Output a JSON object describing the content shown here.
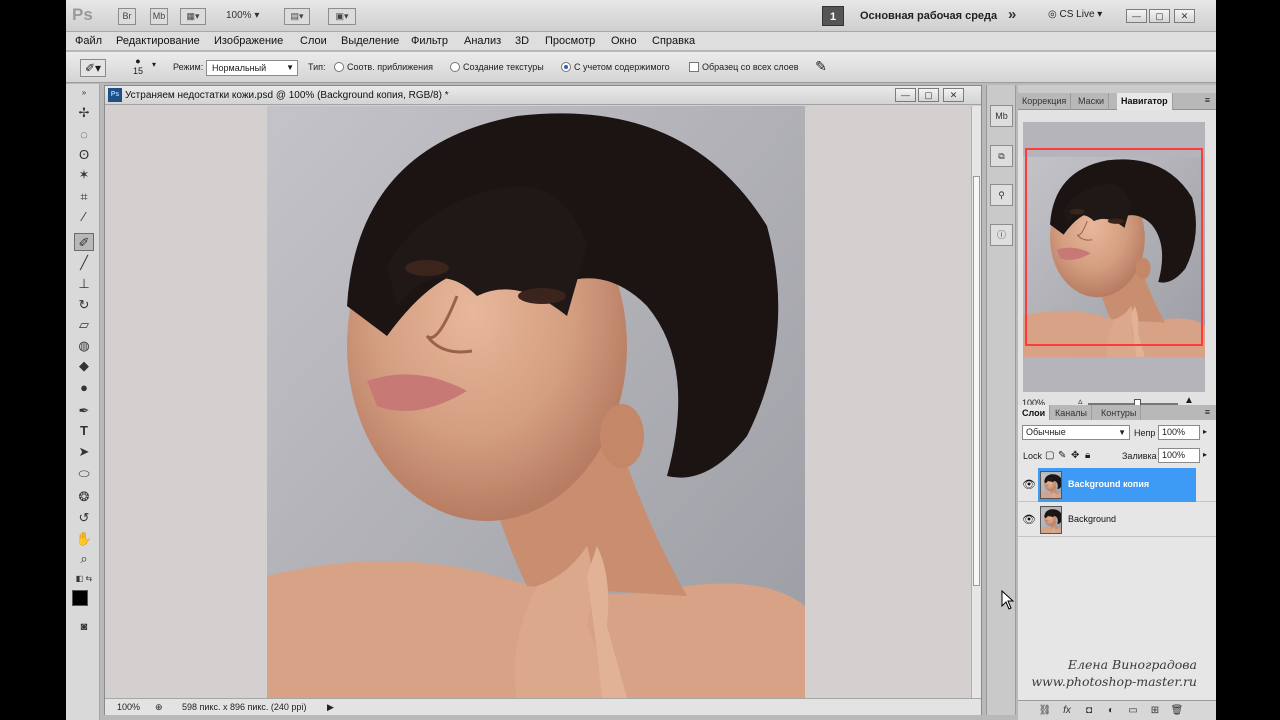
{
  "titlebar": {
    "logo": "Ps",
    "bridge": "Br",
    "minibridge": "Mb",
    "zoom": "100%",
    "workspace_number": "1",
    "workspace_name": "Основная рабочая среда",
    "cs_live": "CS Live"
  },
  "menu": [
    "Файл",
    "Редактирование",
    "Изображение",
    "Слои",
    "Выделение",
    "Фильтр",
    "Анализ",
    "3D",
    "Просмотр",
    "Окно",
    "Справка"
  ],
  "options": {
    "brush_size": "15",
    "mode_label": "Режим:",
    "mode_value": "Нормальный",
    "type_label": "Тип:",
    "type_options": [
      "Соотв. приближения",
      "Создание текстуры",
      "С учетом содержимого"
    ],
    "type_selected": "С учетом содержимого",
    "sample_all_label": "Образец со всех слоев"
  },
  "document": {
    "title": "Устраняем недостатки кожи.psd @ 100% (Background копия, RGB/8) *",
    "status_zoom": "100%",
    "status_info": "598 пикс. x 896 пикс. (240 ppi)"
  },
  "navigator": {
    "tabs": [
      "Коррекция",
      "Маски",
      "Навигатор"
    ],
    "active_tab": "Навигатор",
    "zoom": "100%"
  },
  "layers": {
    "tabs": [
      "Слои",
      "Каналы",
      "Контуры"
    ],
    "active_tab": "Слои",
    "blend_mode": "Обычные",
    "opacity_label": "Непр",
    "opacity_value": "100%",
    "lock_label": "Lock",
    "fill_label": "Заливка",
    "fill_value": "100%",
    "items": [
      {
        "name": "Background копия",
        "selected": true
      },
      {
        "name": "Background",
        "selected": false
      }
    ]
  },
  "watermark": {
    "author": "Елена Виноградова",
    "site": "www.photoshop-master.ru"
  },
  "colors": {
    "selection": "#3d9bf5",
    "navigator_box": "#ff3b3b"
  }
}
